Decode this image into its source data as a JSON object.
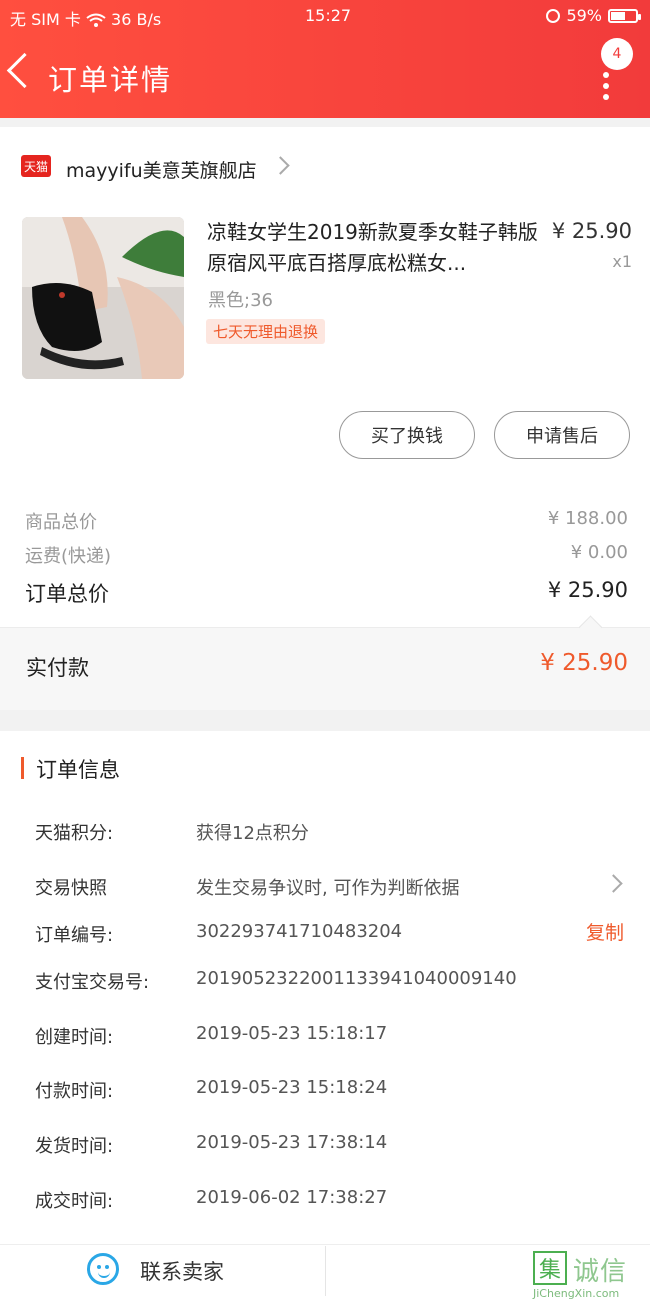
{
  "status_bar": {
    "carrier": "无 SIM 卡",
    "speed": "36 B/s",
    "time": "15:27",
    "battery": "59%",
    "battery_level": 0.59
  },
  "header": {
    "title": "订单详情",
    "message_count": "4"
  },
  "shop": {
    "platform_badge": "天猫",
    "name": "mayyifu美意芙旗舰店"
  },
  "product": {
    "title": "凉鞋女学生2019新款夏季女鞋子韩版原宿风平底百搭厚底松糕女...",
    "price": "¥ 25.90",
    "qty": "x1",
    "sku": "黑色;36",
    "tag": "七天无理由退换"
  },
  "actions": {
    "exchange": "买了换钱",
    "aftersale": "申请售后"
  },
  "pricing": {
    "goods_label": "商品总价",
    "goods_value": "¥ 188.00",
    "ship_label": "运费(快递)",
    "ship_value": "¥ 0.00",
    "total_label": "订单总价",
    "total_value": "¥ 25.90",
    "paid_label": "实付款",
    "paid_value": "¥ 25.90"
  },
  "order_info": {
    "title": "订单信息",
    "points_label": "天猫积分:",
    "points_value": "获得12点积分",
    "snapshot_label": "交易快照",
    "snapshot_value": "发生交易争议时, 可作为判断依据",
    "order_no_label": "订单编号:",
    "order_no_value": "302293741710483204",
    "copy": "复制",
    "alipay_label": "支付宝交易号:",
    "alipay_value": "2019052322001133941040009140",
    "created_label": "创建时间:",
    "created_value": "2019-05-23 15:18:17",
    "paid_label": "付款时间:",
    "paid_value": "2019-05-23 15:18:24",
    "shipped_label": "发货时间:",
    "shipped_value": "2019-05-23 17:38:14",
    "done_label": "成交时间:",
    "done_value": "2019-06-02 17:38:27"
  },
  "bottom": {
    "contact": "联系卖家"
  },
  "watermark": {
    "icon": "集",
    "text": "诚信",
    "url": "JiChengXin.com"
  },
  "colors": {
    "header_red": "#f23b3b",
    "accent_orange": "#ef5a2c",
    "chat_blue": "#2aa7e6"
  }
}
